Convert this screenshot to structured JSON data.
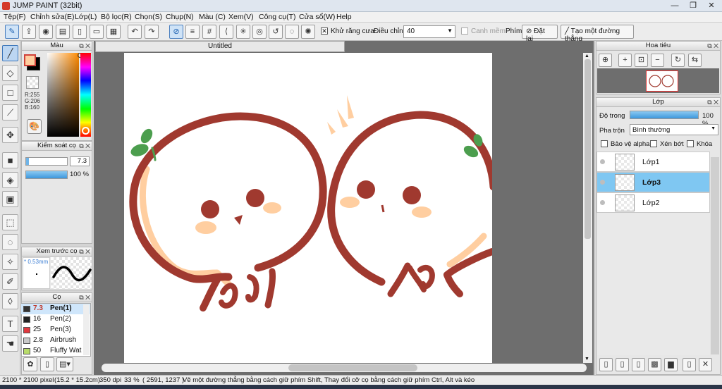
{
  "window": {
    "title": "JUMP PAINT (32bit)",
    "min": "—",
    "max": "❐",
    "close": "✕"
  },
  "menu": [
    "Tệp(F)",
    "Chỉnh sửa(E)",
    "Lớp(L)",
    "Bộ lọc(R)",
    "Chọn(S)",
    "Chụp(N)",
    "Màu (C)",
    "Xem(V)",
    "Công cụ(T)",
    "Cửa sổ(W)",
    "Help"
  ],
  "toolbar": {
    "antialias_label": "Khử răng cưa",
    "adjust_label": "Điều chỉnh",
    "adjust_value": "40",
    "smooth_label": "Canh mềm",
    "key_label": "Phím",
    "reset_label": "Đặt lại",
    "straight_label": "Tạo một đường thẳng"
  },
  "color_panel": {
    "title": "Màu",
    "r": "R:255",
    "g": "G:206",
    "b": "B:160",
    "fg_color": "#ffcea0",
    "bg_color": "#000000"
  },
  "brush_control": {
    "title": "Kiểm soát cọ",
    "size": "7.3",
    "opacity": "100 %",
    "size_fraction": 0.07,
    "opacity_fraction": 1.0
  },
  "preview_panel": {
    "title": "Xem trước cọ",
    "size": "* 0.53mm"
  },
  "brush_panel": {
    "title": "Cọ",
    "items": [
      {
        "size": "7.3",
        "name": "Pen(1)",
        "color": "#333333",
        "selected": true
      },
      {
        "size": "16",
        "name": "Pen(2)",
        "color": "#222222",
        "selected": false
      },
      {
        "size": "25",
        "name": "Pen(3)",
        "color": "#e0383e",
        "selected": false
      },
      {
        "size": "2.8",
        "name": "Airbrush",
        "color": "#c9c9c9",
        "selected": false
      },
      {
        "size": "50",
        "name": "Fluffy Wat",
        "color": "#b8dc6b",
        "selected": false
      }
    ]
  },
  "document": {
    "tab": "Untitled"
  },
  "navigator": {
    "title": "Hoa tiêu"
  },
  "layer_panel": {
    "title": "Lớp",
    "opacity_label": "Độ trong",
    "opacity_value": "100 %",
    "blend_label": "Pha trộn",
    "blend_value": "Bình thường",
    "protect_alpha": "Bảo vệ alpha",
    "clipping": "Xén bớt",
    "lock": "Khóa",
    "layers": [
      {
        "name": "Lớp1",
        "selected": false
      },
      {
        "name": "Lớp3",
        "selected": true
      },
      {
        "name": "Lớp2",
        "selected": false
      }
    ]
  },
  "status": {
    "size": "2100 * 2100 pixel",
    "cm": "(15.2 * 15.2cm)",
    "dpi": "350 dpi",
    "zoom": "33 %",
    "coords": "( 2591, 1237 )",
    "hint": "Vẽ một đường thẳng bằng cách giữ phím Shift, Thay đổi cỡ cọ bằng cách giữ phím Ctrl, Alt và kéo"
  },
  "art_colors": {
    "outline": "#a0392f",
    "skin": "#ffcea0",
    "leaf": "#4c9e4e"
  }
}
